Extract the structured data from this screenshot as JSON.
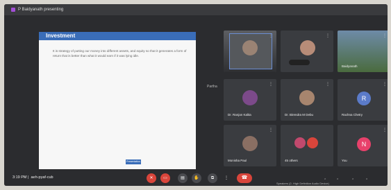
{
  "topbar": {
    "presenting_text": "P Baidyanath presenting"
  },
  "slide": {
    "title": "Investment",
    "body": "It is strategy of putting our money into different assets, and equity so that it generates a form of return that is better than what it would earn if it was lying idle.",
    "button": "Presentation"
  },
  "divider_label": "Partha",
  "participants": [
    {
      "name": "",
      "avatar_letter": "",
      "avatar_color": ""
    },
    {
      "name": "",
      "avatar_letter": "",
      "avatar_color": ""
    },
    {
      "name": "Baidyanath",
      "avatar_letter": "",
      "avatar_color": ""
    },
    {
      "name": "Dr. Ranjan Kalita",
      "avatar_letter": "",
      "avatar_color": ""
    },
    {
      "name": "Dr. Birendra M Debu",
      "avatar_letter": "",
      "avatar_color": ""
    },
    {
      "name": "Rachna Chetry",
      "avatar_letter": "R",
      "avatar_color": "#5b7bc9"
    },
    {
      "name": "Monisha Paul",
      "avatar_letter": "",
      "avatar_color": ""
    },
    {
      "name": "45 others",
      "avatar_letter": "",
      "avatar_color": ""
    },
    {
      "name": "You",
      "avatar_letter": "N",
      "avatar_color": "#e8416b"
    }
  ],
  "bottombar": {
    "time": "3:19 PM",
    "meeting_code": "aeh-pyaf-cub",
    "speaker_label": "Speakers (2- High Definition Audio Device)"
  }
}
